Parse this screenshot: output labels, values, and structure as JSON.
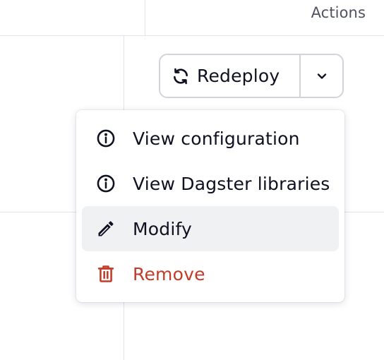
{
  "table": {
    "actions_header": "Actions"
  },
  "redeploy": {
    "label": "Redeploy",
    "icon": "refresh-icon",
    "dropdown_icon": "chevron-down-icon"
  },
  "menu": {
    "items": [
      {
        "label": "View configuration",
        "icon": "info-icon",
        "style": "default"
      },
      {
        "label": "View Dagster libraries",
        "icon": "info-icon",
        "style": "default"
      },
      {
        "label": "Modify",
        "icon": "pencil-icon",
        "style": "hovered"
      },
      {
        "label": "Remove",
        "icon": "trash-icon",
        "style": "danger"
      }
    ]
  },
  "colors": {
    "text": "#0f1020",
    "muted": "#4f5260",
    "border": "#d2d4da",
    "hover_bg": "#f0f1f3",
    "danger": "#c23c2a"
  }
}
